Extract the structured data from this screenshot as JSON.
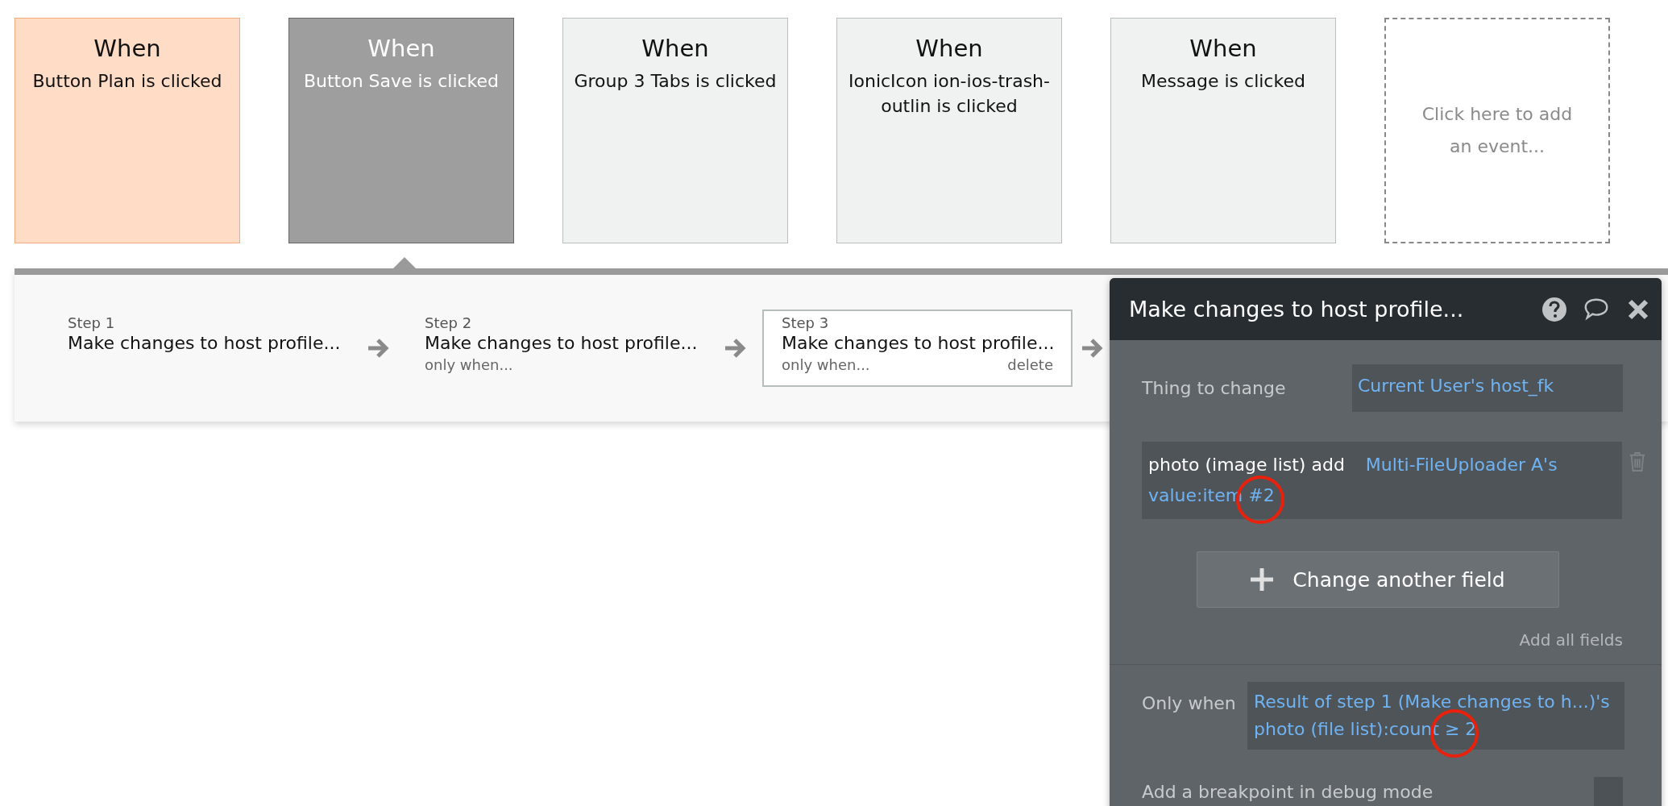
{
  "events": [
    {
      "title": "When",
      "trigger": "Button Plan is clicked",
      "selected": false,
      "highlighted": true
    },
    {
      "title": "When",
      "trigger": "Button Save is clicked",
      "selected": true,
      "highlighted": false
    },
    {
      "title": "When",
      "trigger": "Group 3 Tabs is clicked",
      "selected": false,
      "highlighted": false
    },
    {
      "title": "When",
      "trigger": "IonicIcon ion-ios-trash-outlin is clicked",
      "selected": false,
      "highlighted": false
    },
    {
      "title": "When",
      "trigger": "Message is clicked",
      "selected": false,
      "highlighted": false
    }
  ],
  "add_event": {
    "label": "Click here to add an event..."
  },
  "steps": [
    {
      "number": "Step 1",
      "action": "Make changes to host profile...",
      "selected": false
    },
    {
      "number": "Step 2",
      "action": "Make changes to host profile...",
      "condition": "only when...",
      "selected": false
    },
    {
      "number": "Step 3",
      "action": "Make changes to host profile...",
      "condition": "only when...",
      "delete": "delete",
      "selected": true
    }
  ],
  "panel": {
    "title": "Make changes to host profile...",
    "thing_label": "Thing to change",
    "thing_value": "Current User's host_fk",
    "field_name": "photo (image list) add",
    "field_value": "Multi-FileUploader A's value:item #2",
    "change_button": "Change another field",
    "add_all": "Add all fields",
    "only_when_label": "Only when",
    "only_when_value": "Result of step 1 (Make changes to h...)'s photo (file list):count ≥ 2",
    "breakpoint_label": "Add a breakpoint in debug mode",
    "breakpoint_checked": false
  }
}
